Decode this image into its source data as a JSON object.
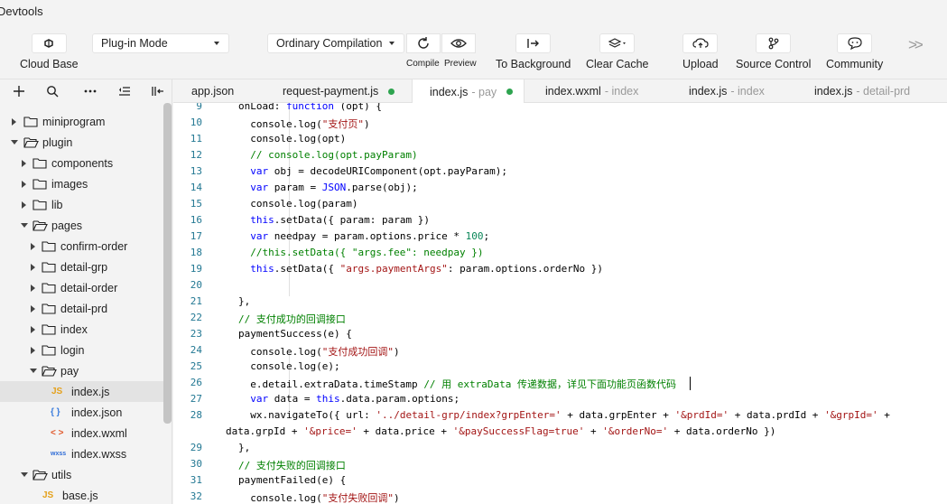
{
  "window": {
    "title": "Devtools"
  },
  "toolbar": {
    "cloud_base": "Cloud Base",
    "mode_select": "Plug-in Mode",
    "compile_select": "Ordinary Compilation",
    "compile_label": "Compile",
    "preview_label": "Preview",
    "to_background": "To Background",
    "clear_cache": "Clear Cache",
    "upload": "Upload",
    "source_control": "Source Control",
    "community": "Community"
  },
  "tabs": [
    {
      "name": "app.json",
      "sub": "",
      "modified": false
    },
    {
      "name": "request-payment.js",
      "sub": "",
      "modified": true
    },
    {
      "name": "index.js",
      "sub": "- pay",
      "modified": true
    },
    {
      "name": "index.wxml",
      "sub": "- index",
      "modified": false
    },
    {
      "name": "index.js",
      "sub": "- index",
      "modified": false
    },
    {
      "name": "index.js",
      "sub": "- detail-prd",
      "modified": false
    }
  ],
  "tree": [
    {
      "label": "miniprogram",
      "type": "folder",
      "expanded": false
    },
    {
      "label": "plugin",
      "type": "folder",
      "expanded": true
    },
    {
      "label": "components",
      "type": "folder",
      "expanded": false
    },
    {
      "label": "images",
      "type": "folder",
      "expanded": false
    },
    {
      "label": "lib",
      "type": "folder",
      "expanded": false
    },
    {
      "label": "pages",
      "type": "folder",
      "expanded": true
    },
    {
      "label": "confirm-order",
      "type": "folder",
      "expanded": false
    },
    {
      "label": "detail-grp",
      "type": "folder",
      "expanded": false
    },
    {
      "label": "detail-order",
      "type": "folder",
      "expanded": false
    },
    {
      "label": "detail-prd",
      "type": "folder",
      "expanded": false
    },
    {
      "label": "index",
      "type": "folder",
      "expanded": false
    },
    {
      "label": "login",
      "type": "folder",
      "expanded": false
    },
    {
      "label": "pay",
      "type": "folder",
      "expanded": true
    },
    {
      "label": "index.js",
      "type": "js",
      "icon_text": "JS",
      "selected": true
    },
    {
      "label": "index.json",
      "type": "json",
      "icon_text": "{ }"
    },
    {
      "label": "index.wxml",
      "type": "wxml",
      "icon_text": "< >"
    },
    {
      "label": "index.wxss",
      "type": "wxss",
      "icon_text": "wxss"
    },
    {
      "label": "utils",
      "type": "folder",
      "expanded": true
    },
    {
      "label": "base.js",
      "type": "js",
      "icon_text": "JS"
    }
  ],
  "line_numbers": [
    "9",
    "10",
    "11",
    "12",
    "13",
    "14",
    "15",
    "16",
    "17",
    "18",
    "19",
    "20",
    "21",
    "22",
    "23",
    "24",
    "25",
    "26",
    "27",
    "28",
    "",
    "29",
    "30",
    "31",
    "32"
  ],
  "code": {
    "l9_a": "onLoad: ",
    "l9_b": "function",
    "l9_c": " (opt) {",
    "l10_a": "  console.log(",
    "l10_b": "\"支付页\"",
    "l10_c": ")",
    "l11": "  console.log(opt)",
    "l12": "  // console.log(opt.payParam)",
    "l13_a": "  ",
    "l13_b": "var",
    "l13_c": " obj = decodeURIComponent(opt.payParam);",
    "l14_a": "  ",
    "l14_b": "var",
    "l14_c": " param = ",
    "l14_d": "JSON",
    "l14_e": ".parse(obj);",
    "l15": "  console.log(param)",
    "l16_a": "  ",
    "l16_b": "this",
    "l16_c": ".setData({ param: param })",
    "l17_a": "  ",
    "l17_b": "var",
    "l17_c": " needpay = param.options.price * ",
    "l17_d": "100",
    "l17_e": ";",
    "l18_a": "  //this.setData({ \"args.fee\": needpay })",
    "l19_a": "  ",
    "l19_b": "this",
    "l19_c": ".setData({ ",
    "l19_d": "\"args.paymentArgs\"",
    "l19_e": ": param.options.orderNo })",
    "l21": "},",
    "l22": "// 支付成功的回调接口",
    "l23": "paymentSuccess(e) {",
    "l24_a": "  console.log(",
    "l24_b": "\"支付成功回调\"",
    "l24_c": ")",
    "l25": "  console.log(e);",
    "l26_a": "  e.detail.extraData.timeStamp ",
    "l26_b": "// 用 extraData 传递数据，详见下面功能页函数代码",
    "l27_a": "  ",
    "l27_b": "var",
    "l27_c": " data = ",
    "l27_d": "this",
    "l27_e": ".data.param.options;",
    "l28_a": "  wx.navigateTo({ url: ",
    "l28_b": "'../detail-grp/index?grpEnter='",
    "l28_c": " + data.grpEnter + ",
    "l28_d": "'&prdId='",
    "l28_e": " + data.prdId + ",
    "l28_f": "'&grpId='",
    "l28_g": " +",
    "l28w_a": "data.grpId + ",
    "l28w_b": "'&price='",
    "l28w_c": " + data.price + ",
    "l28w_d": "'&paySuccessFlag=true'",
    "l28w_e": " + ",
    "l28w_f": "'&orderNo='",
    "l28w_g": " + data.orderNo })",
    "l29": "},",
    "l30": "// 支付失败的回调接口",
    "l31": "paymentFailed(e) {",
    "l32_a": "  console.log(",
    "l32_b": "\"支付失败回调\"",
    "l32_c": ")"
  }
}
